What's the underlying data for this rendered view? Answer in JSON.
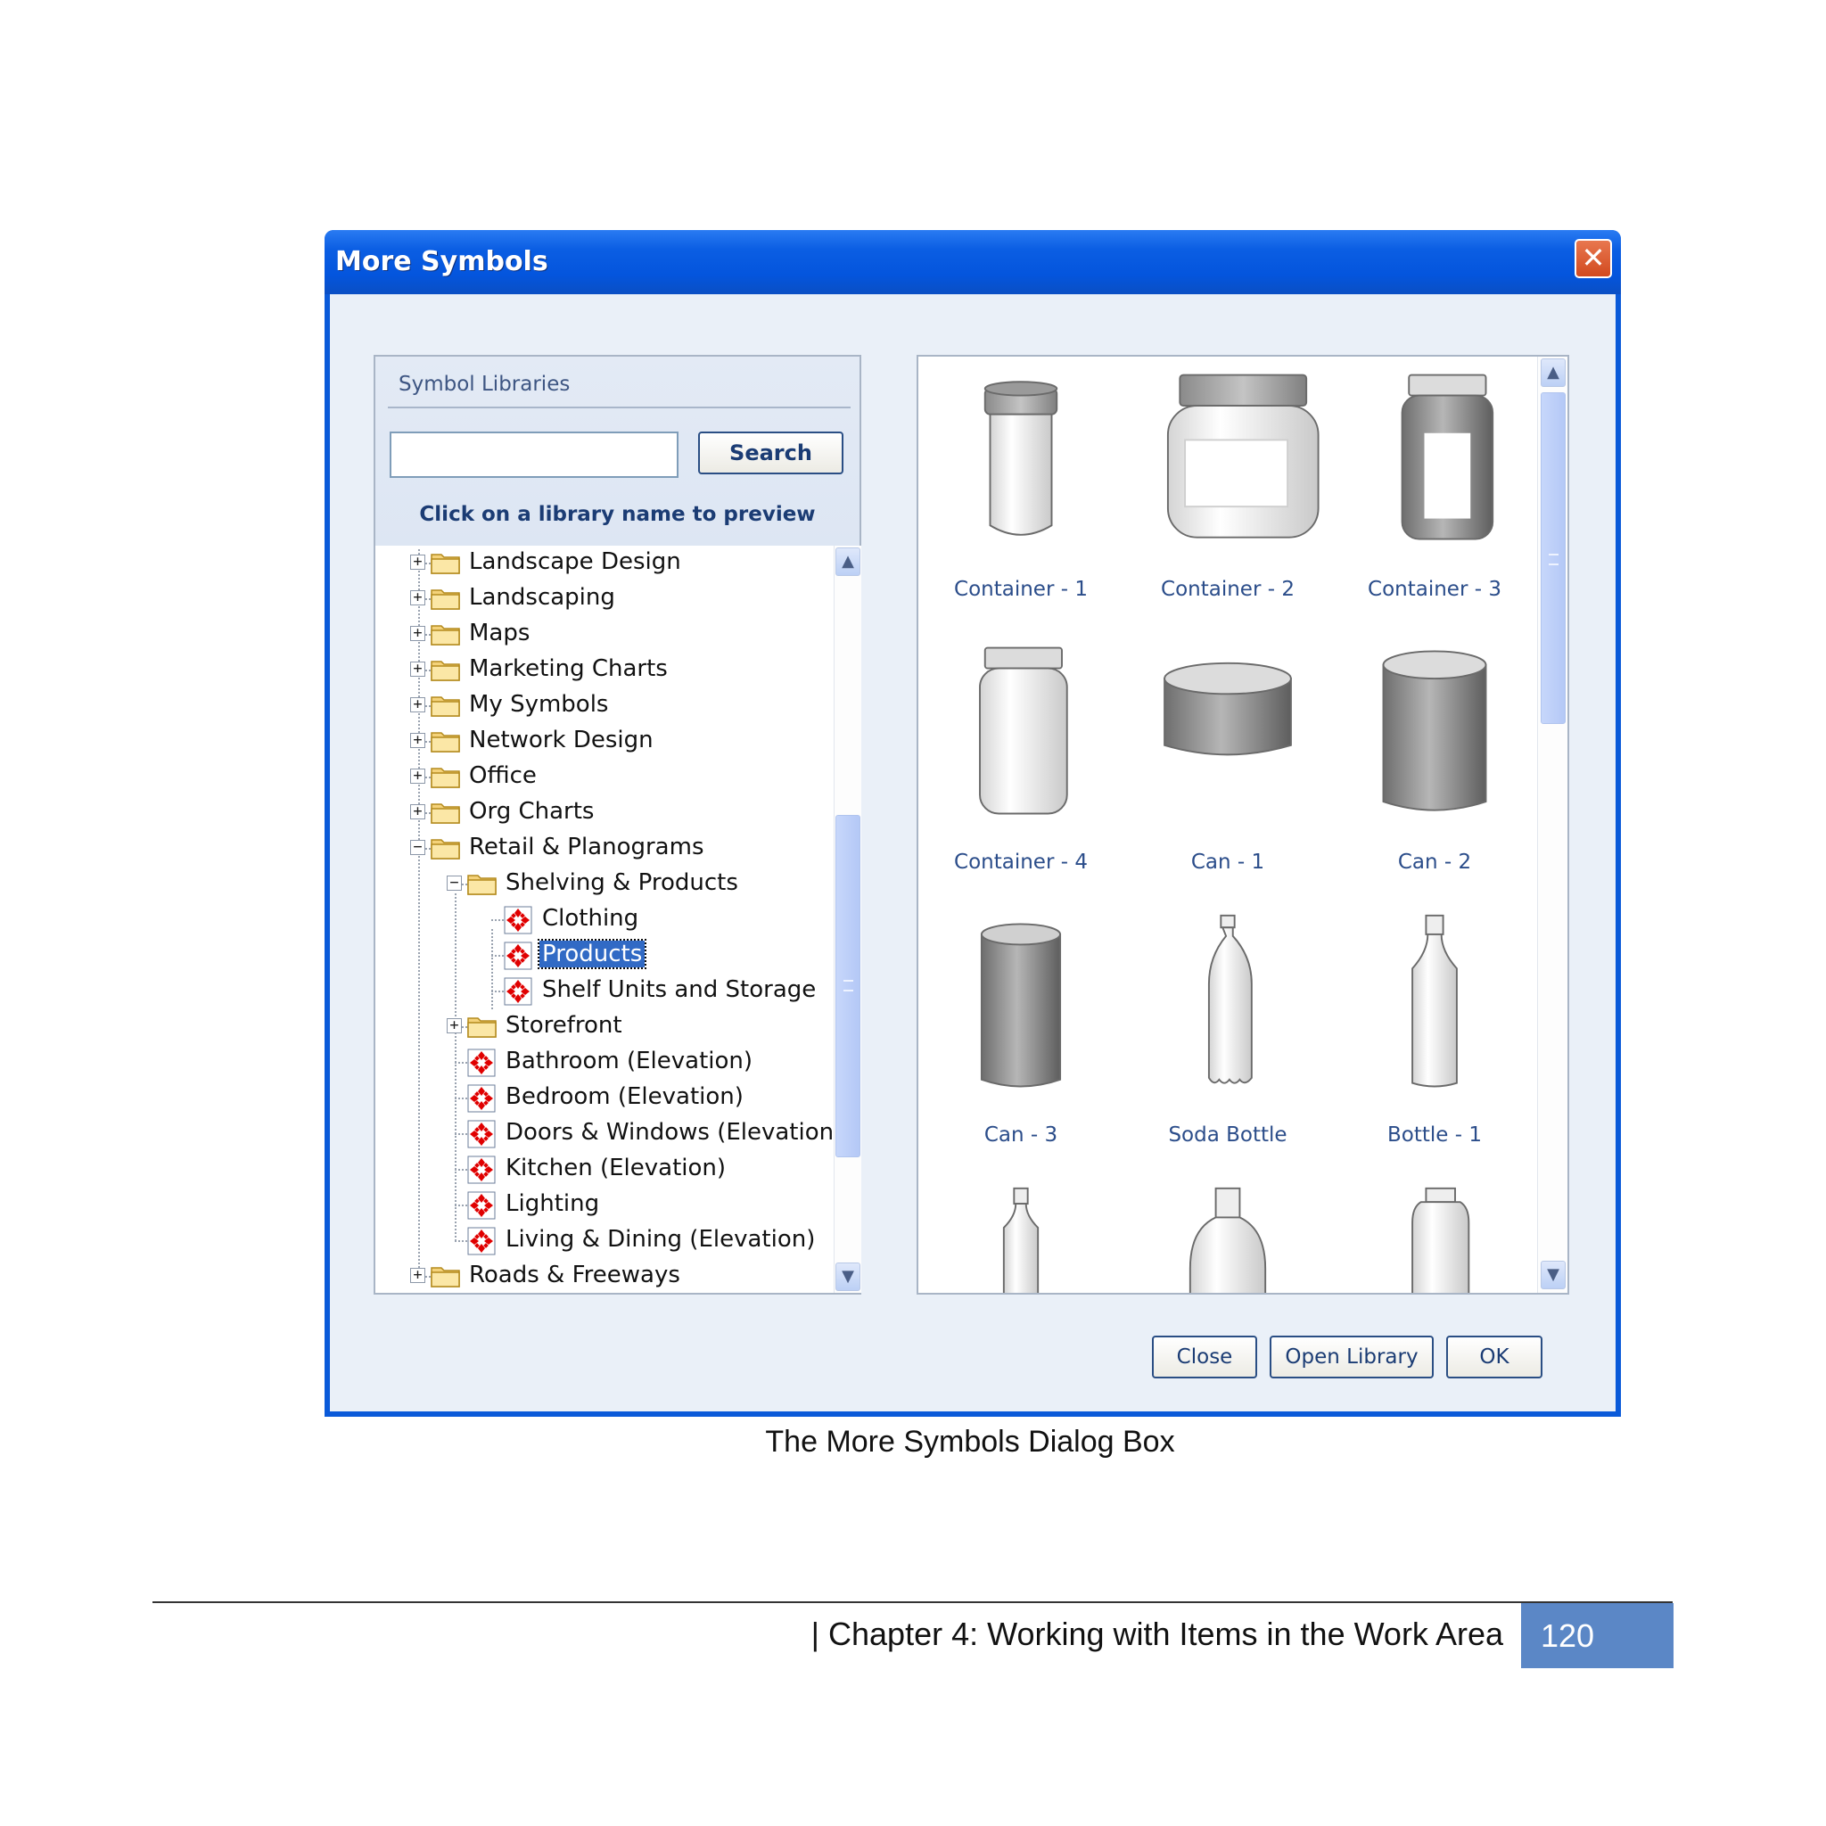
{
  "dialog": {
    "title": "More Symbols",
    "close_glyph": "✕"
  },
  "libraries_panel": {
    "title": "Symbol Libraries",
    "search_value": "",
    "search_button": "Search",
    "hint": "Click on a library name to preview",
    "tree": [
      {
        "label": "Landscape Design",
        "type": "folder",
        "state": "collapsed",
        "level": 0
      },
      {
        "label": "Landscaping",
        "type": "folder",
        "state": "collapsed",
        "level": 0
      },
      {
        "label": "Maps",
        "type": "folder",
        "state": "collapsed",
        "level": 0
      },
      {
        "label": "Marketing Charts",
        "type": "folder",
        "state": "collapsed",
        "level": 0
      },
      {
        "label": "My Symbols",
        "type": "folder",
        "state": "collapsed",
        "level": 0
      },
      {
        "label": "Network Design",
        "type": "folder",
        "state": "collapsed",
        "level": 0
      },
      {
        "label": "Office",
        "type": "folder",
        "state": "collapsed",
        "level": 0
      },
      {
        "label": "Org Charts",
        "type": "folder",
        "state": "collapsed",
        "level": 0
      },
      {
        "label": "Retail & Planograms",
        "type": "folder",
        "state": "expanded",
        "level": 0
      },
      {
        "label": "Shelving & Products",
        "type": "folder",
        "state": "expanded",
        "level": 1
      },
      {
        "label": "Clothing",
        "type": "library",
        "level": 2
      },
      {
        "label": "Products",
        "type": "library",
        "level": 2,
        "selected": true
      },
      {
        "label": "Shelf Units and Storage",
        "type": "library",
        "level": 2
      },
      {
        "label": "Storefront",
        "type": "folder",
        "state": "collapsed",
        "level": 1
      },
      {
        "label": "Bathroom (Elevation)",
        "type": "library",
        "level": 1
      },
      {
        "label": "Bedroom (Elevation)",
        "type": "library",
        "level": 1
      },
      {
        "label": "Doors & Windows (Elevation)",
        "type": "library",
        "level": 1
      },
      {
        "label": "Kitchen (Elevation)",
        "type": "library",
        "level": 1
      },
      {
        "label": "Lighting",
        "type": "library",
        "level": 1
      },
      {
        "label": "Living & Dining (Elevation)",
        "type": "library",
        "level": 1
      },
      {
        "label": "Roads & Freeways",
        "type": "folder",
        "state": "collapsed",
        "level": 0
      }
    ]
  },
  "preview": {
    "symbols": [
      {
        "label": "Container - 1",
        "shape": "container-1"
      },
      {
        "label": "Container - 2",
        "shape": "container-2"
      },
      {
        "label": "Container - 3",
        "shape": "container-3"
      },
      {
        "label": "Container - 4",
        "shape": "container-4"
      },
      {
        "label": "Can - 1",
        "shape": "can-1"
      },
      {
        "label": "Can - 2",
        "shape": "can-2"
      },
      {
        "label": "Can - 3",
        "shape": "can-3"
      },
      {
        "label": "Soda Bottle",
        "shape": "soda-bottle"
      },
      {
        "label": "Bottle - 1",
        "shape": "bottle-1"
      },
      {
        "label": "",
        "shape": "bottle-partial-1"
      },
      {
        "label": "",
        "shape": "bottle-partial-2"
      },
      {
        "label": "",
        "shape": "bottle-partial-3"
      }
    ]
  },
  "buttons": {
    "close": "Close",
    "open_library": "Open Library",
    "ok": "OK"
  },
  "caption": "The More Symbols Dialog Box",
  "footer": {
    "chapter": "| Chapter 4: Working with Items in the Work Area",
    "page_number": "120"
  },
  "colors": {
    "title_bar": "#0455dd",
    "selection": "#316ac5",
    "page_box": "#5b87c6",
    "symbol_label": "#2b4d8a"
  },
  "icons": {
    "folder": "folder-icon",
    "library": "symbol-library-icon",
    "expand": "plus-box-icon",
    "collapse": "minus-box-icon"
  }
}
